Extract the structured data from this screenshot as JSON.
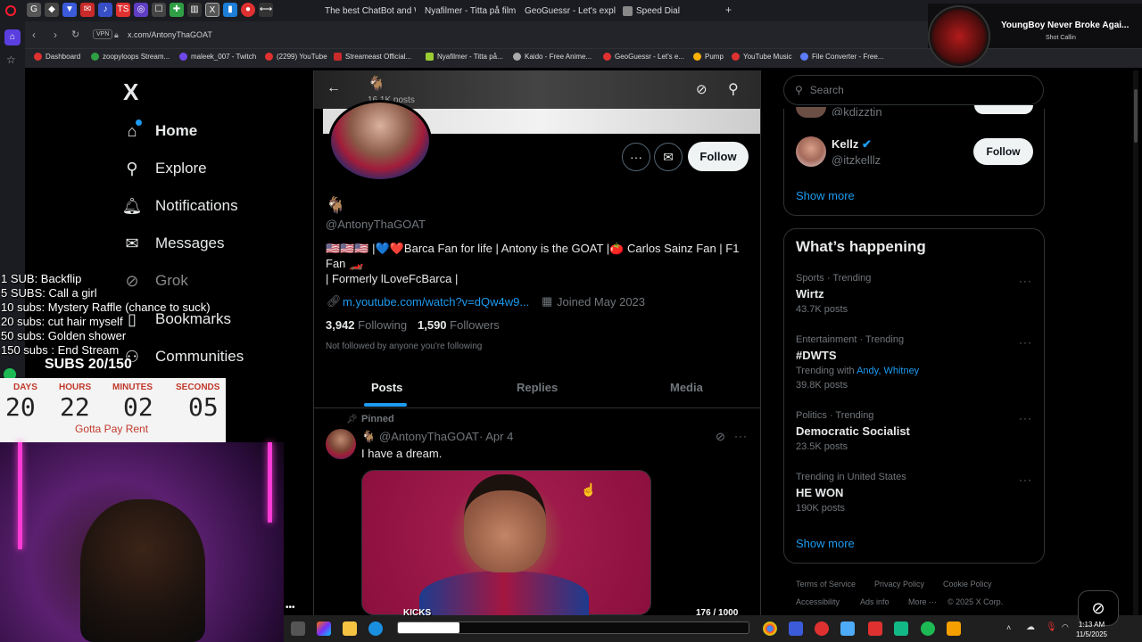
{
  "browser": {
    "tabs": [
      {
        "label": "The best ChatBot and Wi"
      },
      {
        "label": "Nyafilmer - Titta på filmer"
      },
      {
        "label": "GeoGuessr - Let's explore"
      },
      {
        "label": "Speed Dial"
      }
    ],
    "vpn_label": "VPN",
    "url": "x.com/AntonyThaGOAT",
    "bookmarks": [
      "Dashboard",
      "zoopyloops Stream...",
      "maleek_007 - Twitch",
      "(2299) YouTube",
      "Streameast Official...",
      "Nyafilmer - Titta på...",
      "Kaido - Free Anime...",
      "GeoGuessr - Let's e...",
      "Pump",
      "YouTube Music",
      "File Converter - Free..."
    ]
  },
  "music": {
    "title": "YoungBoy Never Broke Agai...",
    "artist": "Shot Callin"
  },
  "nav": {
    "logo": "X",
    "items": [
      {
        "label": "Home",
        "icon": "home-icon"
      },
      {
        "label": "Explore",
        "icon": "search-icon"
      },
      {
        "label": "Notifications",
        "icon": "bell-icon"
      },
      {
        "label": "Messages",
        "icon": "mail-icon"
      },
      {
        "label": "Grok",
        "icon": "grok-icon"
      },
      {
        "label": "Bookmarks",
        "icon": "bookmark-icon"
      },
      {
        "label": "Communities",
        "icon": "communities-icon"
      }
    ]
  },
  "profile": {
    "header_name": "🐐",
    "post_count": "16.1K posts",
    "display_name": "🐐",
    "handle": "@AntonyThaGOAT",
    "bio_line1": "🇺🇸🇺🇸🇺🇸 |💙❤️Barca Fan for life | Antony is the GOAT |🍅 Carlos Sainz Fan | F1",
    "bio_line2": "Fan 🏎️",
    "bio_line3": "| Formerly lLoveFcBarca |",
    "website": "m.youtube.com/watch?v=dQw4w9...",
    "joined": "Joined May 2023",
    "following_count": "3,942",
    "following_label": "Following",
    "followers_count": "1,590",
    "followers_label": "Followers",
    "not_followed": "Not followed by anyone you're following",
    "follow_label": "Follow",
    "tabs": [
      "Posts",
      "Replies",
      "Media"
    ]
  },
  "post": {
    "pinned_label": "Pinned",
    "author_name": "🐐",
    "author_handle": "@AntonyThaGOAT",
    "date": "· Apr 4",
    "text": "I have a dream."
  },
  "right": {
    "search_placeholder": "Search",
    "wtf_partial_handle": "@kdizztin",
    "wtf_user": {
      "name": "Kellz",
      "handle": "@itzkelllz",
      "follow_label": "Follow"
    },
    "wtf_show_more": "Show more",
    "happening_title": "What’s happening",
    "trends": [
      {
        "meta": "Sports · Trending",
        "name": "Wirtz",
        "extra": "43.7K posts"
      },
      {
        "meta": "Entertainment · Trending",
        "name": "#DWTS",
        "with_label": "Trending with",
        "with_links": "Andy, Whitney",
        "extra": "39.8K posts"
      },
      {
        "meta": "Politics · Trending",
        "name": "Democratic Socialist",
        "extra": "23.5K posts"
      },
      {
        "meta": "Trending in United States",
        "name": "HE WON",
        "extra": "190K posts"
      }
    ],
    "happening_show_more": "Show more",
    "footer": [
      "Terms of Service",
      "Privacy Policy",
      "Cookie Policy",
      "Accessibility",
      "Ads info",
      "More ···",
      "© 2025 X Corp."
    ]
  },
  "stream": {
    "goals": [
      "1 SUB: Backflip",
      "5 SUBS: Call a girl",
      "10 subs: Mystery Raffle (chance to suck)",
      "20 subs: cut hair myself",
      "50 subs: Golden shower",
      "150 subs : End Stream"
    ],
    "subs_counter": "SUBS 20/150",
    "timer": {
      "labels": [
        "DAYS",
        "HOURS",
        "MINUTES",
        "SECONDS"
      ],
      "values": [
        "20",
        "22",
        "02",
        "05"
      ],
      "caption": "Gotta Pay Rent"
    },
    "kicks_label": "KICKS",
    "kicks_count": "176  / 1000",
    "kicks_progress": 0.176
  },
  "taskbar": {
    "time": "1:13 AM",
    "date": "11/5/2025"
  },
  "colors": {
    "accent": "#1d9bf0",
    "bg": "#000000",
    "border": "#2f3336",
    "muted": "#71767b",
    "timer_red": "#c0392b"
  }
}
